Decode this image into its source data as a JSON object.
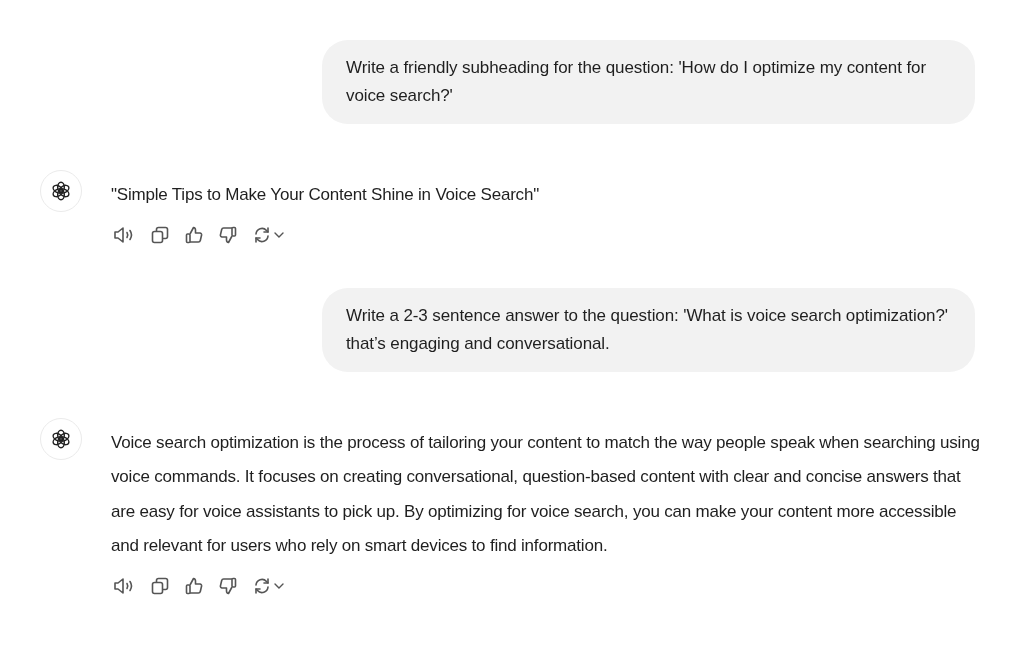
{
  "messages": [
    {
      "kind": "user",
      "text": "Write a friendly subheading for the question: 'How do I optimize my content for voice search?'"
    },
    {
      "kind": "assistant",
      "text": "\"Simple Tips to Make Your Content Shine in Voice Search\""
    },
    {
      "kind": "user",
      "text": "Write a 2-3 sentence answer to the question: 'What is voice search optimization?' that’s engaging and conversational."
    },
    {
      "kind": "assistant",
      "text": "Voice search optimization is the process of tailoring your content to match the way people speak when searching using voice commands. It focuses on creating conversational, question-based content with clear and concise answers that are easy for voice assistants to pick up. By optimizing for voice search, you can make your content more accessible and relevant for users who rely on smart devices to find information."
    }
  ]
}
